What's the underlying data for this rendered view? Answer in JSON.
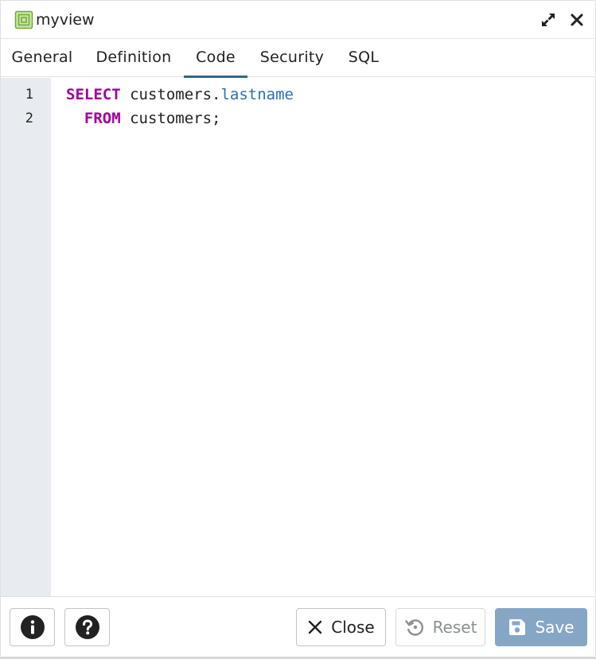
{
  "dialog": {
    "title": "myview",
    "icon": "view-icon",
    "accent_color": "#326690",
    "icon_color": "#8bc34a"
  },
  "tabs": [
    {
      "label": "General",
      "active": false
    },
    {
      "label": "Definition",
      "active": false
    },
    {
      "label": "Code",
      "active": true
    },
    {
      "label": "Security",
      "active": false
    },
    {
      "label": "SQL",
      "active": false
    }
  ],
  "editor": {
    "line_numbers": [
      "1",
      "2"
    ],
    "lines": [
      {
        "keyword": "SELECT",
        "text": " customers.",
        "property": "lastname"
      },
      {
        "indent": "  ",
        "keyword": "FROM",
        "text": " customers;"
      }
    ],
    "keyword_color": "#a1009b",
    "property_color": "#2d6eb3"
  },
  "footer": {
    "info_icon": "info-icon",
    "help_icon": "help-icon",
    "close_label": "Close",
    "reset_label": "Reset",
    "save_label": "Save",
    "save_color": "#86a6c6"
  }
}
